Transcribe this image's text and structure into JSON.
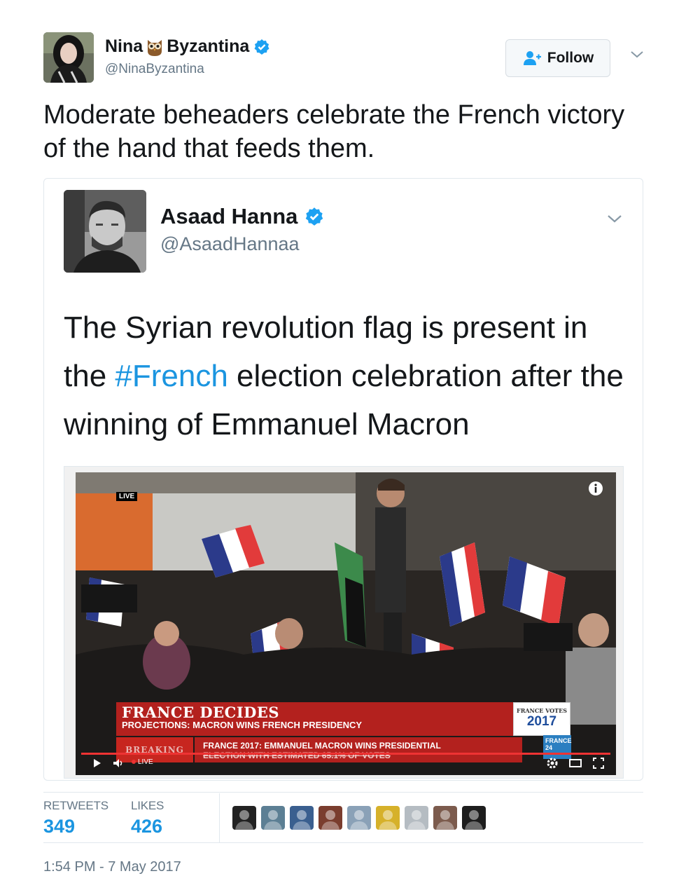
{
  "tweet": {
    "author_name_first": "Nina",
    "author_name_last": "Byzantina",
    "author_handle": "@NinaByzantina",
    "follow_label": "Follow",
    "text": "Moderate beheaders celebrate the French victory of the hand that feeds them.",
    "colors": {
      "verified": "#1da1f2",
      "link": "#1b95e0",
      "secondary_text": "#657786"
    }
  },
  "quoted": {
    "author_name": "Asaad Hanna",
    "author_handle": "@AsaadHannaa",
    "text_before": "The Syrian revolution flag is present in the ",
    "hashtag": "#French",
    "text_after": " election celebration after the winning of Emmanuel Macron",
    "video": {
      "live_badge": "LIVE",
      "lower_third_title": "FRANCE DECIDES",
      "lower_third_subtitle": "PROJECTIONS: MACRON WINS FRENCH PRESIDENCY",
      "breaking_label": "BREAKING",
      "ticker_line1": "FRANCE 2017: EMMANUEL MACRON WINS PRESIDENTIAL",
      "ticker_line2": "ELECTION WITH ESTIMATED 65.1% OF VOTES",
      "box_label": "FRANCE VOTES",
      "box_year": "2017",
      "channel_badge_line1": "FRANCE",
      "channel_badge_line2": "24",
      "control_live_label": "LIVE"
    }
  },
  "stats": {
    "retweets_label": "RETWEETS",
    "retweets_value": "349",
    "likes_label": "LIKES",
    "likes_value": "426"
  },
  "likers": [
    {
      "icon": "liker-avatar-1",
      "color": "#222222"
    },
    {
      "icon": "liker-avatar-2",
      "color": "#5c7f94"
    },
    {
      "icon": "liker-avatar-3",
      "color": "#3a5f8f"
    },
    {
      "icon": "liker-avatar-4",
      "color": "#7a3d2e"
    },
    {
      "icon": "liker-avatar-5",
      "color": "#8aa1b7"
    },
    {
      "icon": "liker-avatar-6",
      "color": "#d6b12a"
    },
    {
      "icon": "liker-avatar-7",
      "color": "#b5bcc2"
    },
    {
      "icon": "liker-avatar-8",
      "color": "#7c5b4d"
    },
    {
      "icon": "liker-avatar-9",
      "color": "#1d1d1d"
    }
  ],
  "timestamp": "1:54 PM - 7 May 2017"
}
